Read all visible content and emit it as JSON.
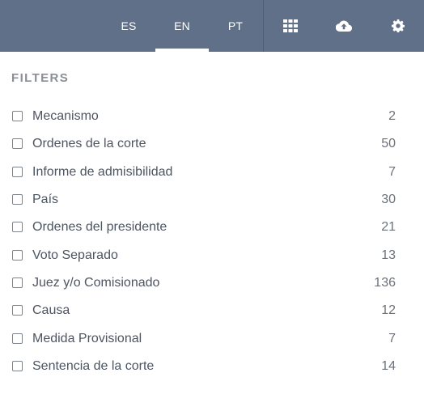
{
  "header": {
    "languages": [
      {
        "label": "ES",
        "active": false
      },
      {
        "label": "EN",
        "active": true
      },
      {
        "label": "PT",
        "active": false
      }
    ],
    "icons": [
      "grid-icon",
      "cloud-upload-icon",
      "gear-icon"
    ],
    "background_color": "#5f7088"
  },
  "filters": {
    "title": "FILTERS",
    "items": [
      {
        "label": "Mecanismo",
        "count": "2",
        "checked": false
      },
      {
        "label": "Ordenes de la corte",
        "count": "50",
        "checked": false
      },
      {
        "label": "Informe de admisibilidad",
        "count": "7",
        "checked": false
      },
      {
        "label": "País",
        "count": "30",
        "checked": false
      },
      {
        "label": "Ordenes del presidente",
        "count": "21",
        "checked": false
      },
      {
        "label": "Voto Separado",
        "count": "13",
        "checked": false
      },
      {
        "label": "Juez y/o Comisionado",
        "count": "136",
        "checked": false
      },
      {
        "label": "Causa",
        "count": "12",
        "checked": false
      },
      {
        "label": "Medida Provisional",
        "count": "7",
        "checked": false
      },
      {
        "label": "Sentencia de la corte",
        "count": "14",
        "checked": false
      }
    ]
  }
}
